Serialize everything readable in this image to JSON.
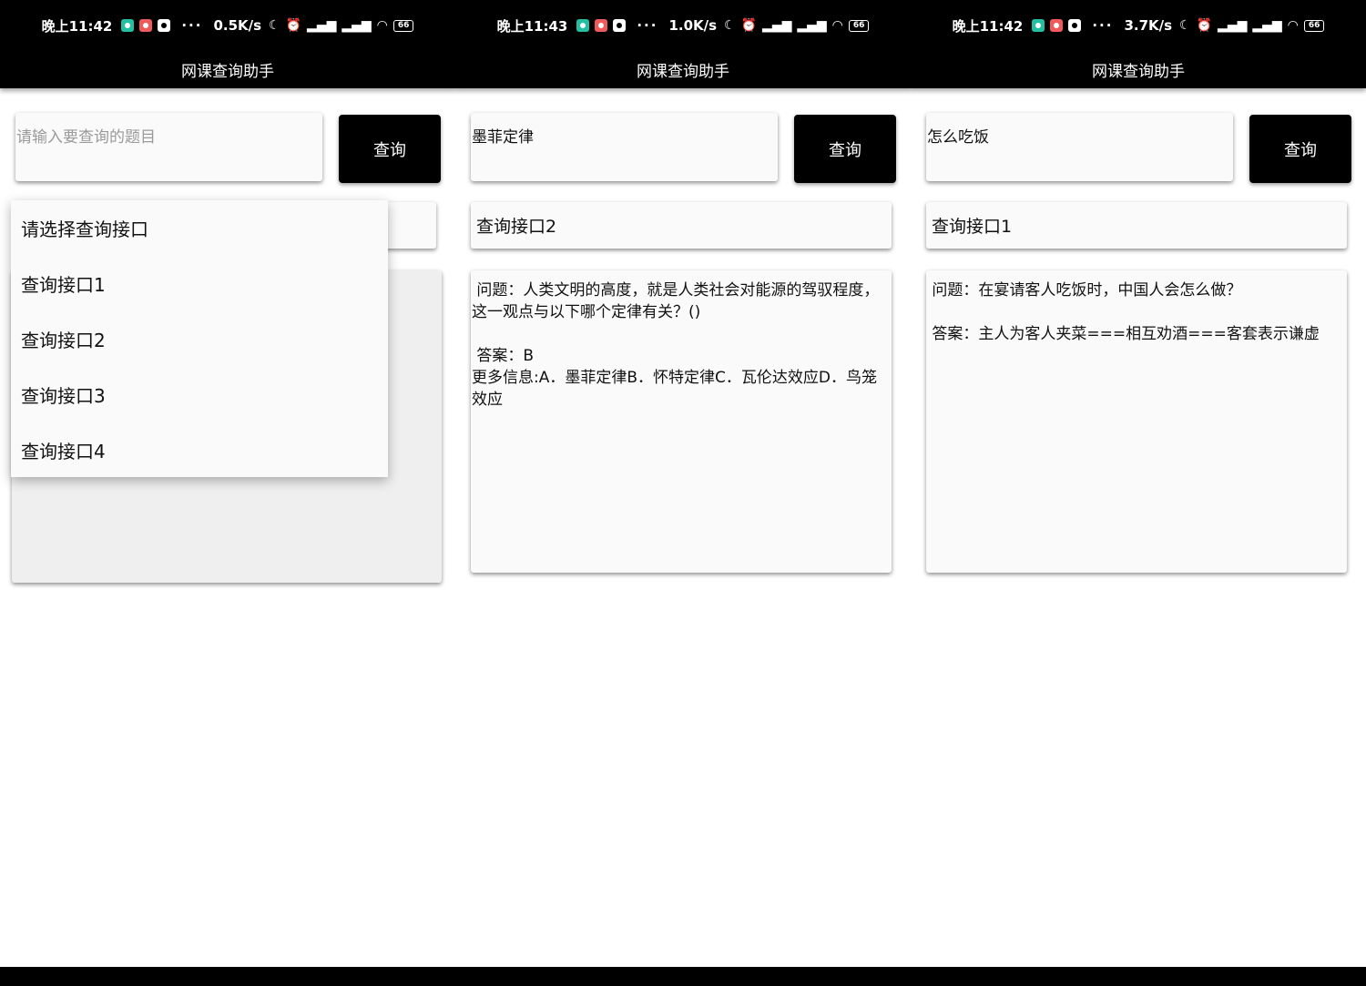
{
  "app_title": "网课查询助手",
  "query_button_label": "查询",
  "panels": [
    {
      "status": {
        "time": "晚上11:42",
        "speed": "0.5K/s",
        "battery": "66"
      },
      "input": {
        "value": "",
        "placeholder": "请输入要查询的题目"
      },
      "spinner_value": "",
      "result_text": "",
      "dropdown": {
        "open": true,
        "items": [
          "请选择查询接口",
          "查询接口1",
          "查询接口2",
          "查询接口3",
          "查询接口4"
        ]
      }
    },
    {
      "status": {
        "time": "晚上11:43",
        "speed": "1.0K/s",
        "battery": "66"
      },
      "input": {
        "value": "墨菲定律",
        "placeholder": ""
      },
      "spinner_value": "查询接口2",
      "result_text": " 问题：人类文明的高度，就是人类社会对能源的驾驭程度，这一观点与以下哪个定律有关？()\n\n 答案：B\n更多信息:A．墨菲定律B．怀特定律C．瓦伦达效应D．鸟笼效应"
    },
    {
      "status": {
        "time": "晚上11:42",
        "speed": "3.7K/s",
        "battery": "66"
      },
      "input": {
        "value": "怎么吃饭",
        "placeholder": ""
      },
      "spinner_value": "查询接口1",
      "result_text": " 问题：在宴请客人吃饭时，中国人会怎么做？\n\n 答案：主人为客人夹菜===相互劝酒===客套表示谦虚"
    }
  ]
}
